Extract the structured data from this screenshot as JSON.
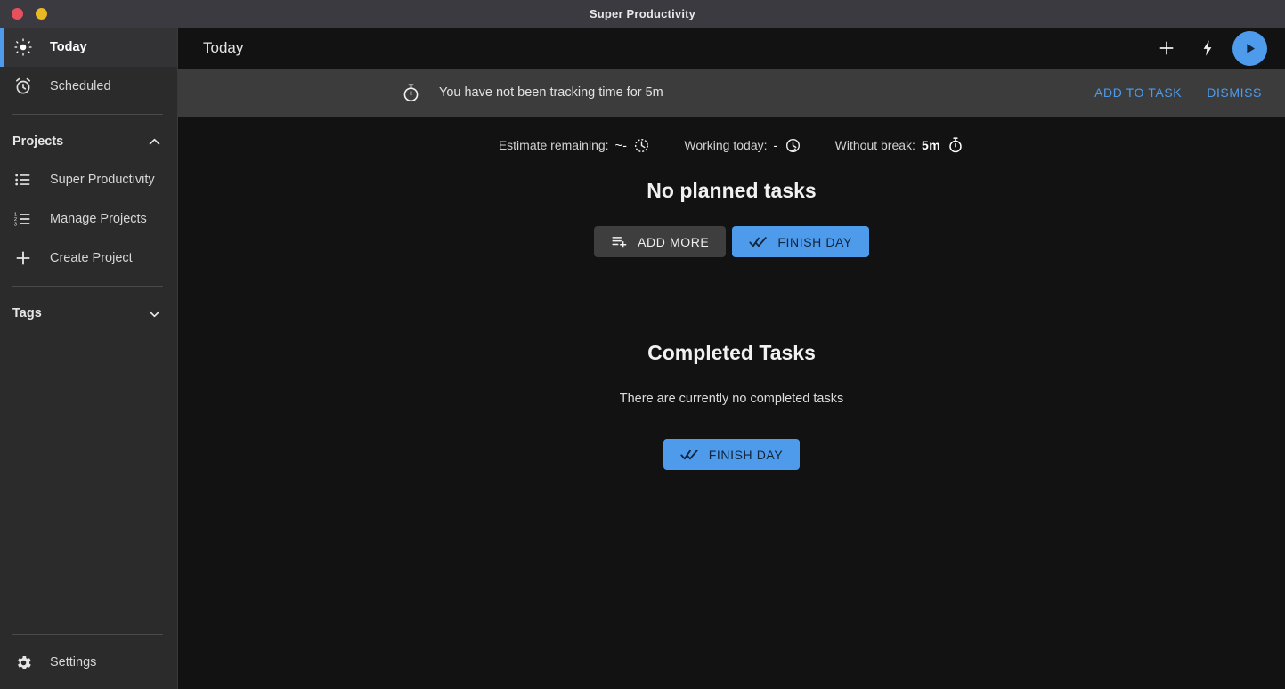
{
  "window": {
    "title": "Super Productivity",
    "controls": [
      {
        "name": "close",
        "color": "#e8505b"
      },
      {
        "name": "minimize",
        "color": "#e9b824"
      }
    ]
  },
  "theme": {
    "accent": "#4e9bec",
    "sidebar_bg": "#2b2b2b",
    "content_bg": "#121212",
    "banner_bg": "#3c3c3c",
    "titlebar_bg": "#3a3a40"
  },
  "sidebar": {
    "primary_items": [
      {
        "label": "Today",
        "icon": "sun-icon",
        "active": true
      },
      {
        "label": "Scheduled",
        "icon": "alarm-clock-icon",
        "active": false
      }
    ],
    "projects_section": {
      "label": "Projects",
      "chevron": "chevron-up-icon",
      "expanded": true,
      "items": [
        {
          "label": "Super Productivity",
          "icon": "list-icon"
        },
        {
          "label": "Manage Projects",
          "icon": "numbered-list-icon"
        },
        {
          "label": "Create Project",
          "icon": "plus-icon"
        }
      ]
    },
    "tags_section": {
      "label": "Tags",
      "chevron": "chevron-down-icon",
      "expanded": false,
      "items": []
    },
    "settings": {
      "label": "Settings",
      "icon": "gear-icon"
    }
  },
  "header": {
    "title": "Today",
    "actions": [
      {
        "name": "add-task-button",
        "icon": "plus-icon"
      },
      {
        "name": "quick-action-button",
        "icon": "lightning-bolt-icon"
      },
      {
        "name": "play-button",
        "icon": "play-icon"
      }
    ]
  },
  "banner": {
    "icon": "stopwatch-icon",
    "message": "You have not been tracking time for 5m",
    "add_to_task_label": "ADD TO TASK",
    "dismiss_label": "DISMISS"
  },
  "stats": [
    {
      "label": "Estimate remaining:",
      "value": "~-",
      "icon": "clock-dashed-icon",
      "bold": false
    },
    {
      "label": "Working today:",
      "value": "-",
      "icon": "clock-check-icon",
      "bold": false
    },
    {
      "label": "Without break:",
      "value": "5m",
      "icon": "stopwatch-icon",
      "bold": true
    }
  ],
  "planned": {
    "title": "No planned tasks",
    "add_more_label": "ADD MORE",
    "add_more_icon": "playlist-add-icon",
    "finish_day_label": "FINISH DAY",
    "finish_day_icon": "double-check-icon"
  },
  "completed": {
    "title": "Completed Tasks",
    "empty_text": "There are currently no completed tasks",
    "finish_day_label": "FINISH DAY",
    "finish_day_icon": "double-check-icon"
  }
}
